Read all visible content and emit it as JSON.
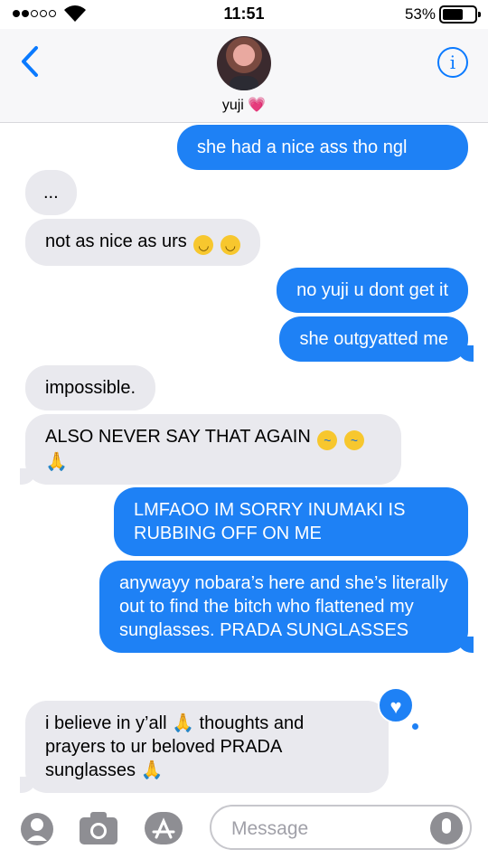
{
  "status": {
    "time": "11:51",
    "battery": "53%"
  },
  "header": {
    "contact_name": "yuji 💗"
  },
  "messages": [
    {
      "from": "me",
      "text": "she had a nice ass tho ngl"
    },
    {
      "from": "them",
      "text": "..."
    },
    {
      "from": "them",
      "text": "not as nice as urs"
    },
    {
      "from": "me",
      "text": "no yuji u dont get it"
    },
    {
      "from": "me",
      "text": "she outgyatted me"
    },
    {
      "from": "them",
      "text": "impossible."
    },
    {
      "from": "them",
      "text": "ALSO NEVER SAY THAT AGAIN"
    },
    {
      "from": "me",
      "text": "LMFAOO IM SORRY INUMAKI IS RUBBING OFF ON ME"
    },
    {
      "from": "me",
      "text": "anywayy nobara’s here and she’s literally out to find the bitch who flattened my sunglasses. PRADA SUNGLASSES"
    },
    {
      "from": "them",
      "text_a": "i believe in y’all",
      "text_b": "thoughts and prayers to ur beloved PRADA sunglasses"
    }
  ],
  "input": {
    "placeholder": "Message"
  },
  "colors": {
    "sent_bubble": "#1e81f5",
    "received_bubble": "#e9e9ee",
    "accent": "#0a7aff"
  }
}
